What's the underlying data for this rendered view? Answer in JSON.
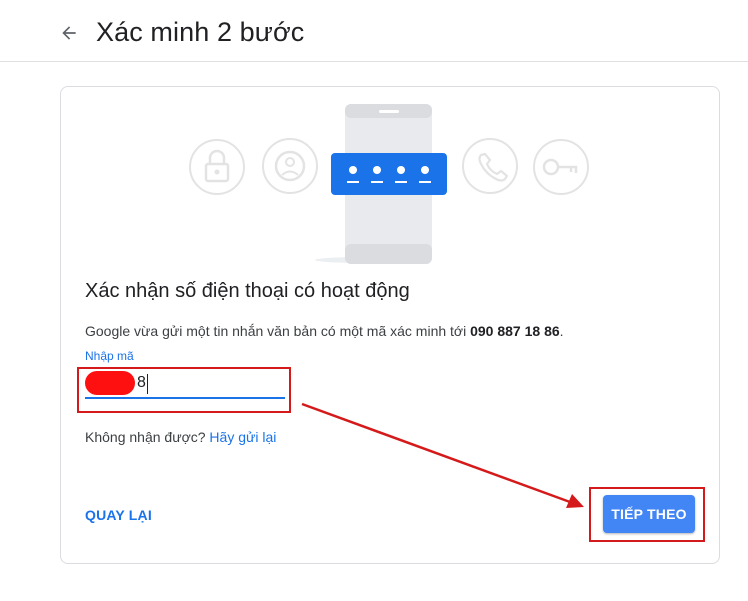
{
  "header": {
    "title": "Xác minh 2 bước",
    "back_icon": "arrow-left-icon"
  },
  "card": {
    "heading": "Xác nhận số điện thoại có hoạt động",
    "description_prefix": "Google vừa gửi một tin nhắn văn bản có một mã xác minh tới ",
    "phone_number": "090 887 18 86",
    "description_suffix": ".",
    "code_field": {
      "label": "Nhập mã",
      "value": "8",
      "redacted": true
    },
    "resend_prompt": "Không nhận được?",
    "resend_link": "Hãy gửi lại",
    "back_button": "QUAY LẠI",
    "next_button": "TIẾP THEO"
  },
  "illustration": {
    "icons": [
      "lock-icon",
      "account-icon",
      "phone-with-code-icon",
      "call-icon",
      "key-icon"
    ]
  },
  "colors": {
    "accent": "#1a73e8",
    "button": "#4285f4",
    "annotation": "#d41a1a",
    "redaction": "#ff1010"
  }
}
